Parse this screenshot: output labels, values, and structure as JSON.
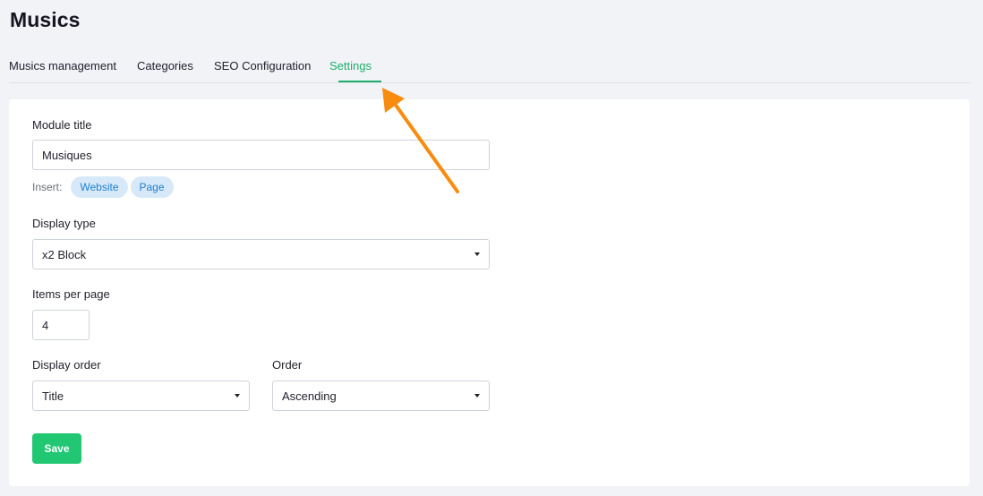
{
  "page": {
    "title": "Musics"
  },
  "tabs": [
    {
      "label": "Musics management",
      "active": false
    },
    {
      "label": "Categories",
      "active": false
    },
    {
      "label": "SEO Configuration",
      "active": false
    },
    {
      "label": "Settings",
      "active": true
    }
  ],
  "form": {
    "module_title": {
      "label": "Module title",
      "value": "Musiques",
      "insert_label": "Insert:",
      "insert_options": [
        "Website",
        "Page"
      ]
    },
    "display_type": {
      "label": "Display type",
      "value": "x2 Block"
    },
    "items_per_page": {
      "label": "Items per page",
      "value": "4"
    },
    "display_order": {
      "label": "Display order",
      "value": "Title"
    },
    "order": {
      "label": "Order",
      "value": "Ascending"
    },
    "save_label": "Save"
  },
  "colors": {
    "accent": "#1eae6b",
    "save_button": "#22c774",
    "chip_bg": "#d7e9f8",
    "chip_text": "#1f80d1",
    "annotation_arrow": "#f98b0e"
  },
  "icons": {
    "select_caret": "caret-down-icon",
    "annotation": "arrow-icon"
  }
}
